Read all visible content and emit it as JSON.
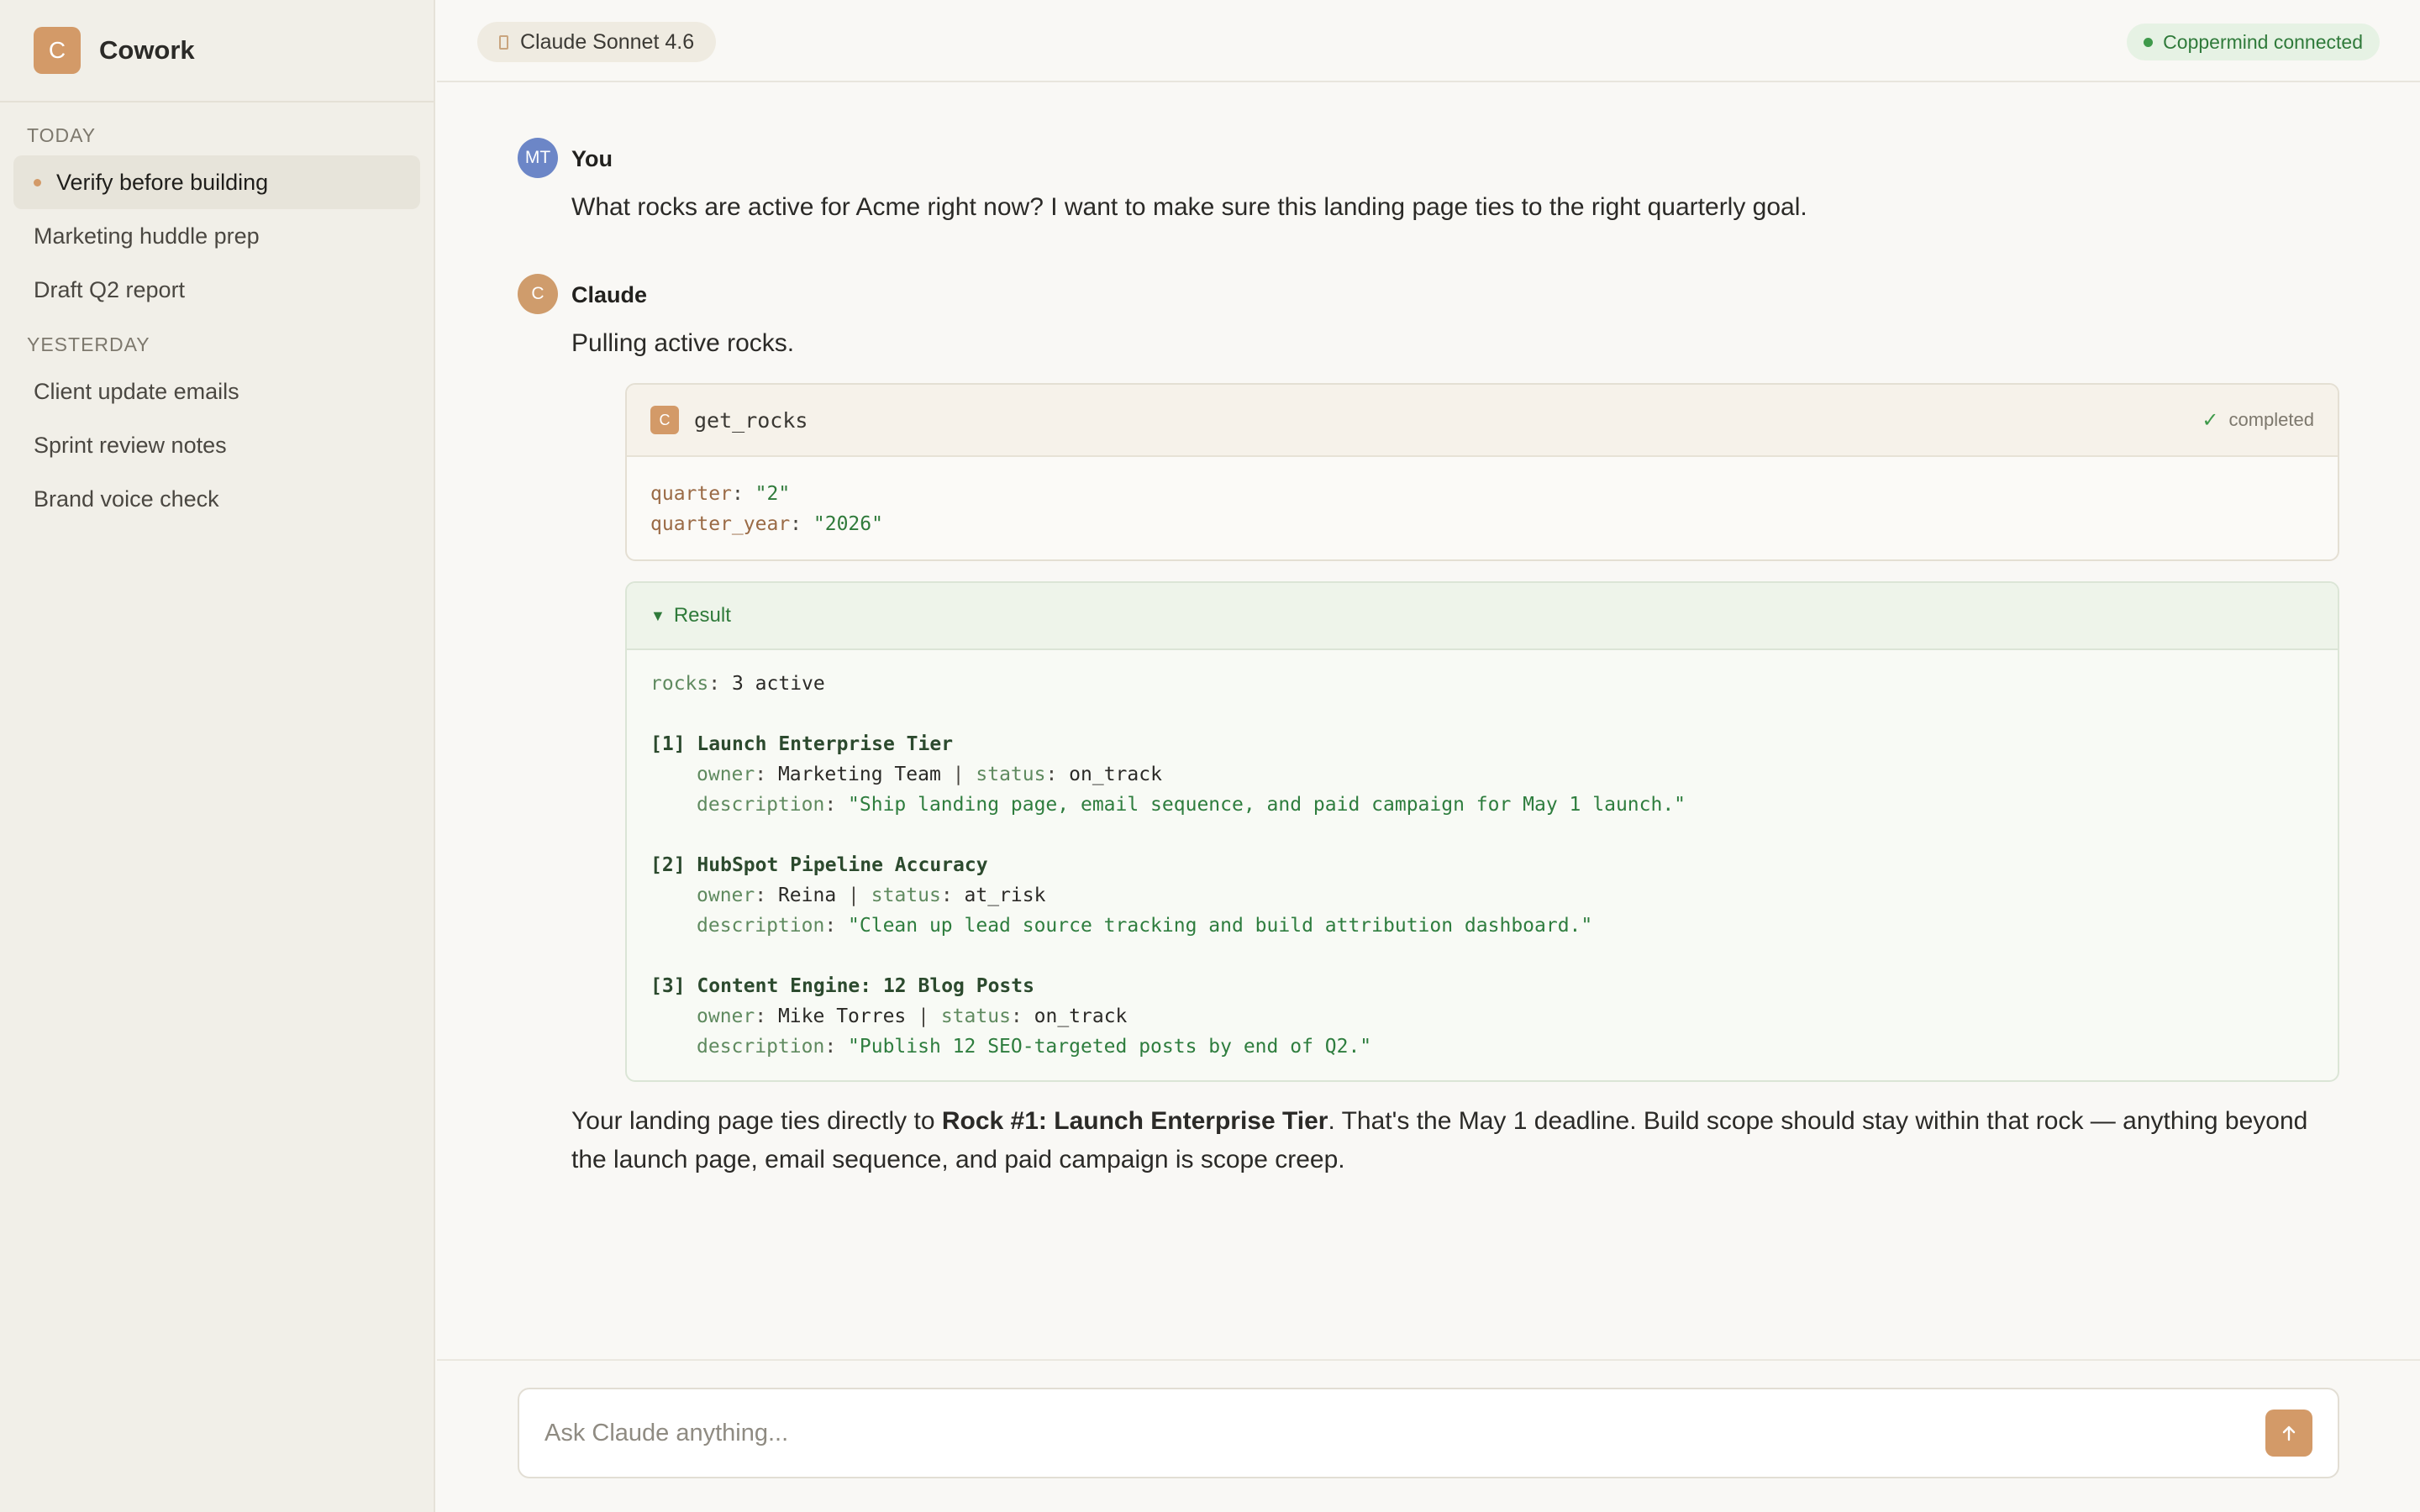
{
  "app": {
    "name": "Cowork",
    "logo_letter": "C"
  },
  "sidebar": {
    "sections": [
      {
        "label": "TODAY",
        "items": [
          {
            "label": "Verify before building",
            "active": true
          },
          {
            "label": "Marketing huddle prep"
          },
          {
            "label": "Draft Q2 report"
          }
        ]
      },
      {
        "label": "YESTERDAY",
        "items": [
          {
            "label": "Client update emails"
          },
          {
            "label": "Sprint review notes"
          },
          {
            "label": "Brand voice check"
          }
        ]
      }
    ]
  },
  "topbar": {
    "model": "Claude Sonnet 4.6",
    "connection_status": "Coppermind connected"
  },
  "conversation": {
    "user": {
      "avatar": "MT",
      "name": "You",
      "text": "What rocks are active for Acme right now? I want to make sure this landing page ties to the right quarterly goal."
    },
    "assistant": {
      "avatar": "C",
      "name": "Claude",
      "intro": "Pulling active rocks.",
      "tool_call": {
        "icon": "C",
        "name": "get_rocks",
        "status": "completed",
        "args": [
          {
            "key": "quarter",
            "value": "\"2\""
          },
          {
            "key": "quarter_year",
            "value": "\"2026\""
          }
        ]
      },
      "result": {
        "label": "Result",
        "summary_key": "rocks",
        "summary_value": "3 active",
        "rocks": [
          {
            "index": "[1]",
            "title": "Launch Enterprise Tier",
            "owner": "Marketing Team",
            "status": "on_track",
            "description": "\"Ship landing page, email sequence, and paid campaign for May 1 launch.\""
          },
          {
            "index": "[2]",
            "title": "HubSpot Pipeline Accuracy",
            "owner": "Reina",
            "status": "at_risk",
            "description": "\"Clean up lead source tracking and build attribution dashboard.\""
          },
          {
            "index": "[3]",
            "title": "Content Engine: 12 Blog Posts",
            "owner": "Mike Torres",
            "status": "on_track",
            "description": "\"Publish 12 SEO-targeted posts by end of Q2.\""
          }
        ]
      },
      "conclusion_pre": "Your landing page ties directly to ",
      "conclusion_bold": "Rock #1: Launch Enterprise Tier",
      "conclusion_post": ". That's the May 1 deadline. Build scope should stay within that rock — anything beyond the launch page, email sequence, and paid campaign is scope creep."
    }
  },
  "input": {
    "placeholder": "Ask Claude anything...",
    "send_icon": "arrow-up-icon"
  },
  "labels": {
    "owner": "owner",
    "status": "status",
    "description": "description"
  },
  "colors": {
    "accent": "#d39a68",
    "success": "#2f7a3a",
    "user_avatar": "#6c86c7"
  }
}
